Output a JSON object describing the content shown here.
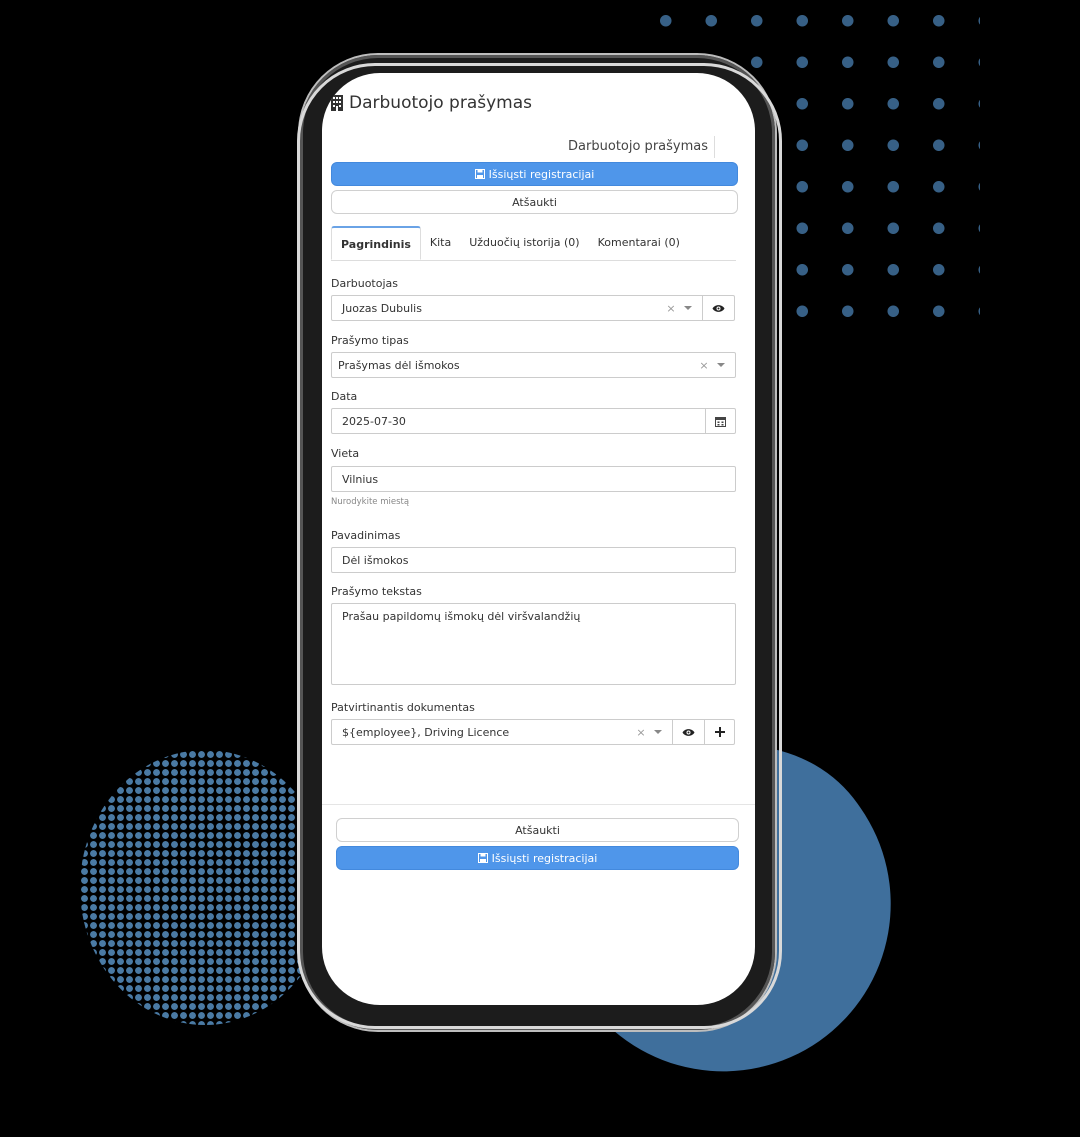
{
  "header": {
    "title": "Darbuotojo prašymas",
    "subtitle": "Darbuotojo prašymas"
  },
  "actions": {
    "submit_label": "Išsiųsti registracijai",
    "cancel_label": "Atšaukti"
  },
  "tabs": [
    {
      "label": "Pagrindinis",
      "active": true
    },
    {
      "label": "Kita"
    },
    {
      "label": "Užduočių istorija (0)"
    },
    {
      "label": "Komentarai (0)"
    }
  ],
  "form": {
    "employee": {
      "label": "Darbuotojas",
      "value": "Juozas Dubulis"
    },
    "request_type": {
      "label": "Prašymo tipas",
      "value": "Prašymas dėl išmokos"
    },
    "date": {
      "label": "Data",
      "value": "2025-07-30"
    },
    "place": {
      "label": "Vieta",
      "value": "Vilnius",
      "help": "Nurodykite miestą"
    },
    "name": {
      "label": "Pavadinimas",
      "value": "Dėl išmokos"
    },
    "text": {
      "label": "Prašymo tekstas",
      "value": "Prašau papildomų išmokų dėl viršvalandžių"
    },
    "document": {
      "label": "Patvirtinantis dokumentas",
      "value": "${employee}, Driving Licence"
    },
    "clear_symbol": "×"
  },
  "colors": {
    "primary": "#4f96ea",
    "brand_blue": "#3f6f9c",
    "background": "#000000"
  }
}
